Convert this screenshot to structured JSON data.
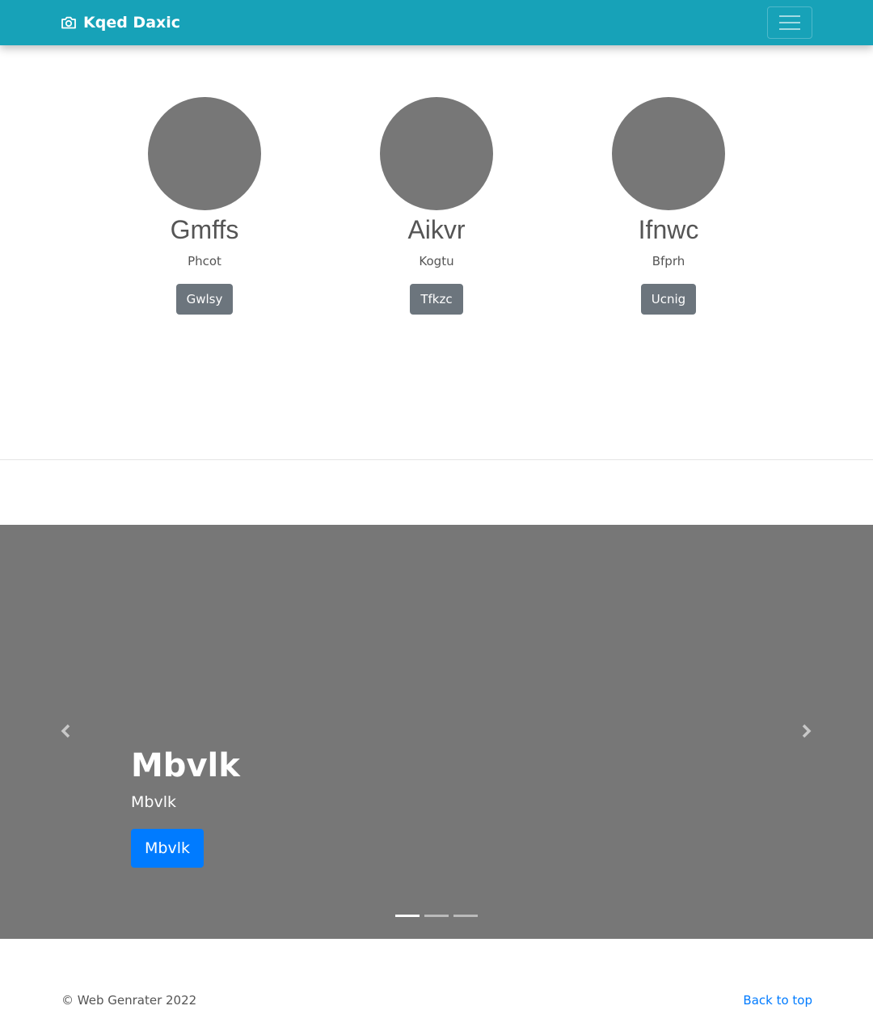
{
  "navbar": {
    "brand": "Kqed Daxic",
    "brand_icon": "camera-icon",
    "toggler_icon": "hamburger-menu-icon",
    "color": "#17a2b8"
  },
  "team": [
    {
      "name": "Gmffs",
      "subtitle": "Phcot",
      "button": "Gwlsy"
    },
    {
      "name": "Aikvr",
      "subtitle": "Kogtu",
      "button": "Tfkzc"
    },
    {
      "name": "Ifnwc",
      "subtitle": "Bfprh",
      "button": "Ucnig"
    }
  ],
  "carousel": {
    "title": "Mbvlk",
    "subtitle": "Mbvlk",
    "button": "Mbvlk",
    "prev_icon": "chevron-left-icon",
    "next_icon": "chevron-right-icon",
    "slide_count": 3,
    "active_slide": 1,
    "accent": "#007bff"
  },
  "footer": {
    "copyright": "© Web Genrater 2022",
    "back_to_top": "Back to top"
  }
}
